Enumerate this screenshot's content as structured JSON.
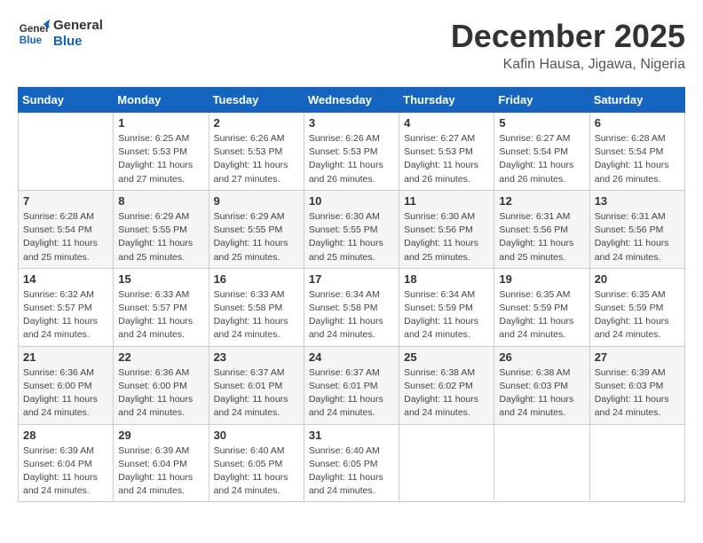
{
  "logo": {
    "line1": "General",
    "line2": "Blue"
  },
  "title": "December 2025",
  "location": "Kafin Hausa, Jigawa, Nigeria",
  "days_of_week": [
    "Sunday",
    "Monday",
    "Tuesday",
    "Wednesday",
    "Thursday",
    "Friday",
    "Saturday"
  ],
  "weeks": [
    [
      {
        "day": "",
        "info": ""
      },
      {
        "day": "1",
        "info": "Sunrise: 6:25 AM\nSunset: 5:53 PM\nDaylight: 11 hours\nand 27 minutes."
      },
      {
        "day": "2",
        "info": "Sunrise: 6:26 AM\nSunset: 5:53 PM\nDaylight: 11 hours\nand 27 minutes."
      },
      {
        "day": "3",
        "info": "Sunrise: 6:26 AM\nSunset: 5:53 PM\nDaylight: 11 hours\nand 26 minutes."
      },
      {
        "day": "4",
        "info": "Sunrise: 6:27 AM\nSunset: 5:53 PM\nDaylight: 11 hours\nand 26 minutes."
      },
      {
        "day": "5",
        "info": "Sunrise: 6:27 AM\nSunset: 5:54 PM\nDaylight: 11 hours\nand 26 minutes."
      },
      {
        "day": "6",
        "info": "Sunrise: 6:28 AM\nSunset: 5:54 PM\nDaylight: 11 hours\nand 26 minutes."
      }
    ],
    [
      {
        "day": "7",
        "info": "Sunrise: 6:28 AM\nSunset: 5:54 PM\nDaylight: 11 hours\nand 25 minutes."
      },
      {
        "day": "8",
        "info": "Sunrise: 6:29 AM\nSunset: 5:55 PM\nDaylight: 11 hours\nand 25 minutes."
      },
      {
        "day": "9",
        "info": "Sunrise: 6:29 AM\nSunset: 5:55 PM\nDaylight: 11 hours\nand 25 minutes."
      },
      {
        "day": "10",
        "info": "Sunrise: 6:30 AM\nSunset: 5:55 PM\nDaylight: 11 hours\nand 25 minutes."
      },
      {
        "day": "11",
        "info": "Sunrise: 6:30 AM\nSunset: 5:56 PM\nDaylight: 11 hours\nand 25 minutes."
      },
      {
        "day": "12",
        "info": "Sunrise: 6:31 AM\nSunset: 5:56 PM\nDaylight: 11 hours\nand 25 minutes."
      },
      {
        "day": "13",
        "info": "Sunrise: 6:31 AM\nSunset: 5:56 PM\nDaylight: 11 hours\nand 24 minutes."
      }
    ],
    [
      {
        "day": "14",
        "info": "Sunrise: 6:32 AM\nSunset: 5:57 PM\nDaylight: 11 hours\nand 24 minutes."
      },
      {
        "day": "15",
        "info": "Sunrise: 6:33 AM\nSunset: 5:57 PM\nDaylight: 11 hours\nand 24 minutes."
      },
      {
        "day": "16",
        "info": "Sunrise: 6:33 AM\nSunset: 5:58 PM\nDaylight: 11 hours\nand 24 minutes."
      },
      {
        "day": "17",
        "info": "Sunrise: 6:34 AM\nSunset: 5:58 PM\nDaylight: 11 hours\nand 24 minutes."
      },
      {
        "day": "18",
        "info": "Sunrise: 6:34 AM\nSunset: 5:59 PM\nDaylight: 11 hours\nand 24 minutes."
      },
      {
        "day": "19",
        "info": "Sunrise: 6:35 AM\nSunset: 5:59 PM\nDaylight: 11 hours\nand 24 minutes."
      },
      {
        "day": "20",
        "info": "Sunrise: 6:35 AM\nSunset: 5:59 PM\nDaylight: 11 hours\nand 24 minutes."
      }
    ],
    [
      {
        "day": "21",
        "info": "Sunrise: 6:36 AM\nSunset: 6:00 PM\nDaylight: 11 hours\nand 24 minutes."
      },
      {
        "day": "22",
        "info": "Sunrise: 6:36 AM\nSunset: 6:00 PM\nDaylight: 11 hours\nand 24 minutes."
      },
      {
        "day": "23",
        "info": "Sunrise: 6:37 AM\nSunset: 6:01 PM\nDaylight: 11 hours\nand 24 minutes."
      },
      {
        "day": "24",
        "info": "Sunrise: 6:37 AM\nSunset: 6:01 PM\nDaylight: 11 hours\nand 24 minutes."
      },
      {
        "day": "25",
        "info": "Sunrise: 6:38 AM\nSunset: 6:02 PM\nDaylight: 11 hours\nand 24 minutes."
      },
      {
        "day": "26",
        "info": "Sunrise: 6:38 AM\nSunset: 6:03 PM\nDaylight: 11 hours\nand 24 minutes."
      },
      {
        "day": "27",
        "info": "Sunrise: 6:39 AM\nSunset: 6:03 PM\nDaylight: 11 hours\nand 24 minutes."
      }
    ],
    [
      {
        "day": "28",
        "info": "Sunrise: 6:39 AM\nSunset: 6:04 PM\nDaylight: 11 hours\nand 24 minutes."
      },
      {
        "day": "29",
        "info": "Sunrise: 6:39 AM\nSunset: 6:04 PM\nDaylight: 11 hours\nand 24 minutes."
      },
      {
        "day": "30",
        "info": "Sunrise: 6:40 AM\nSunset: 6:05 PM\nDaylight: 11 hours\nand 24 minutes."
      },
      {
        "day": "31",
        "info": "Sunrise: 6:40 AM\nSunset: 6:05 PM\nDaylight: 11 hours\nand 24 minutes."
      },
      {
        "day": "",
        "info": ""
      },
      {
        "day": "",
        "info": ""
      },
      {
        "day": "",
        "info": ""
      }
    ]
  ]
}
